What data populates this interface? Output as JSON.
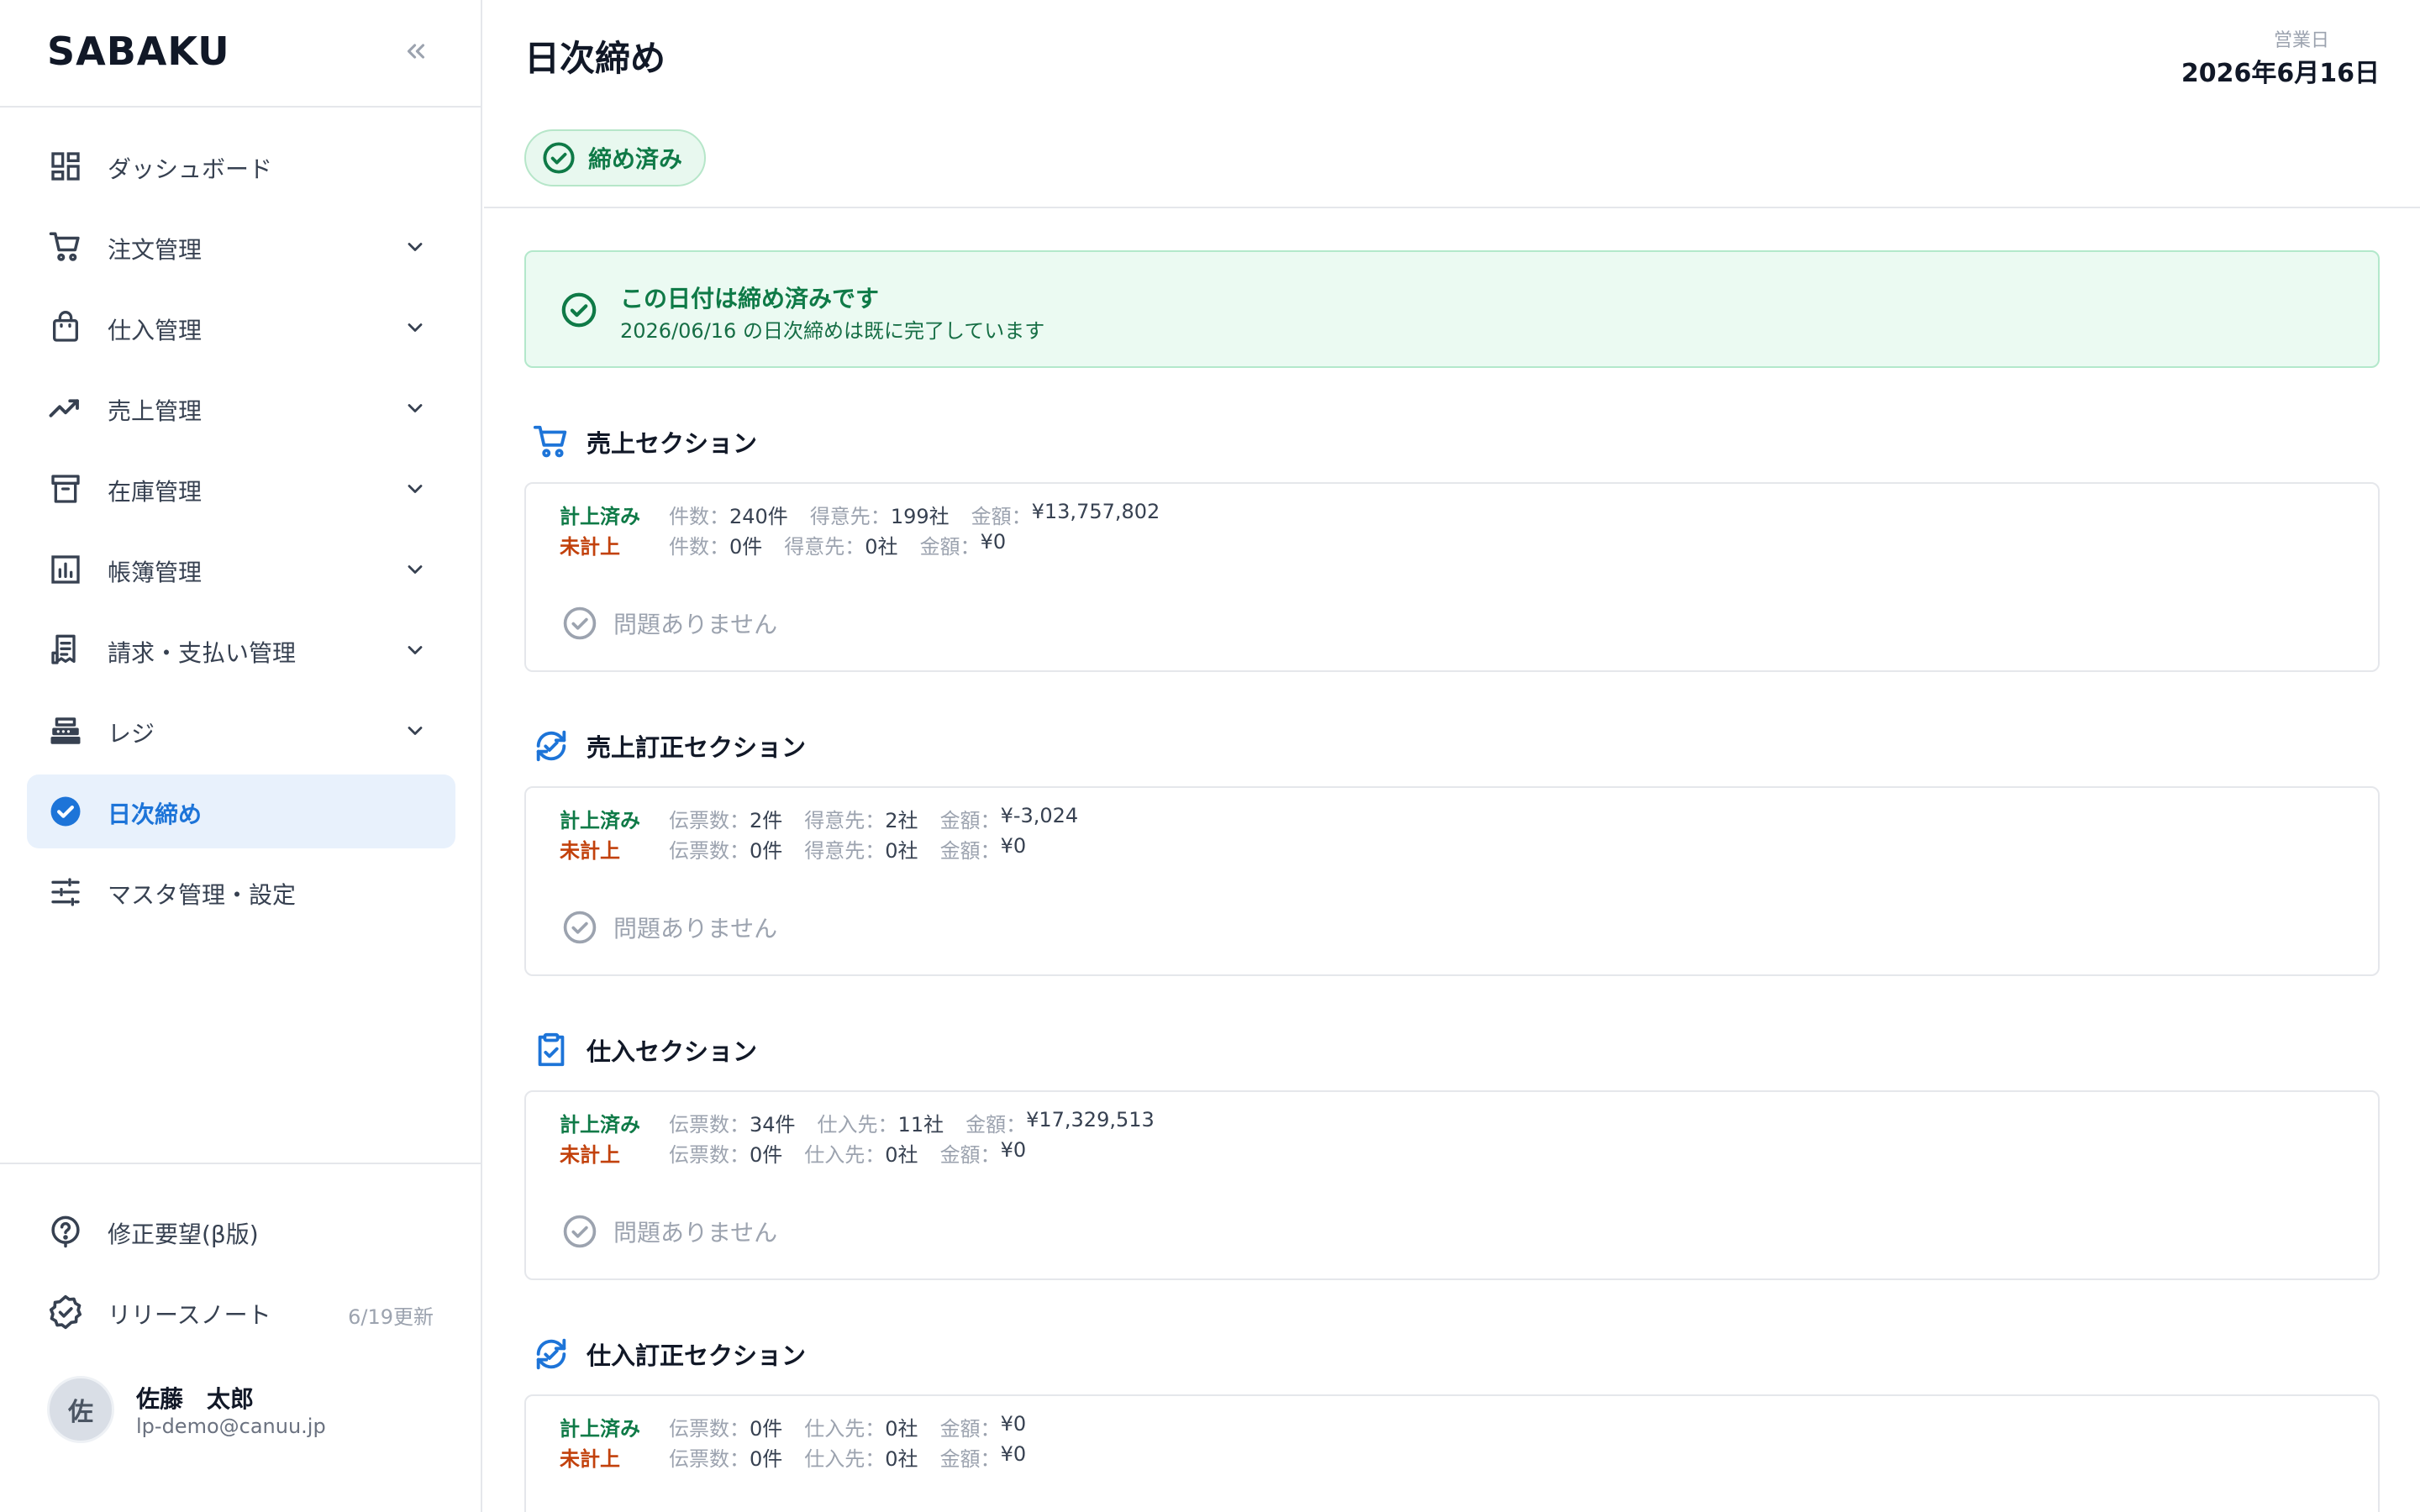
{
  "app": {
    "brand": "SABAKU"
  },
  "sidebar": {
    "items": [
      {
        "label": "ダッシュボード",
        "icon": "dashboard-icon",
        "has_children": false
      },
      {
        "label": "注文管理",
        "icon": "cart-icon",
        "has_children": true
      },
      {
        "label": "仕入管理",
        "icon": "shopping-bag-icon",
        "has_children": true
      },
      {
        "label": "売上管理",
        "icon": "trending-up-icon",
        "has_children": true
      },
      {
        "label": "在庫管理",
        "icon": "archive-box-icon",
        "has_children": true
      },
      {
        "label": "帳簿管理",
        "icon": "bar-chart-icon",
        "has_children": true
      },
      {
        "label": "請求・支払い管理",
        "icon": "receipt-icon",
        "has_children": true
      },
      {
        "label": "レジ",
        "icon": "cash-register-icon",
        "has_children": true
      },
      {
        "label": "日次締め",
        "icon": "check-circle-icon",
        "has_children": false,
        "active": true
      },
      {
        "label": "マスタ管理・設定",
        "icon": "sliders-icon",
        "has_children": false
      }
    ],
    "bottom": {
      "feedback_label": "修正要望(β版)",
      "release_label": "リリースノート",
      "release_meta": "6/19更新"
    },
    "user": {
      "avatar_initial": "佐",
      "name": "佐藤　太郎",
      "email": "lp-demo@canuu.jp"
    }
  },
  "header": {
    "title": "日次締め",
    "business_day_label": "営業日",
    "business_day_value": "2026年6月16日",
    "status_label": "締め済み"
  },
  "alert": {
    "title": "この日付は締め済みです",
    "description": "2026/06/16 の日次締めは既に完了しています"
  },
  "sections": [
    {
      "title": "売上セクション",
      "icon": "cart-icon",
      "recorded": {
        "status": "計上済み",
        "fields": [
          {
            "k": "件数：",
            "v": "240件"
          },
          {
            "k": "得意先：",
            "v": "199社"
          },
          {
            "k": "金額：",
            "v": "¥13,757,802"
          }
        ]
      },
      "unrecorded": {
        "status": "未計上",
        "fields": [
          {
            "k": "件数：",
            "v": "0件"
          },
          {
            "k": "得意先：",
            "v": "0社"
          },
          {
            "k": "金額：",
            "v": "¥0"
          }
        ]
      },
      "issue_text": "問題ありません"
    },
    {
      "title": "売上訂正セクション",
      "icon": "refresh-check-icon",
      "recorded": {
        "status": "計上済み",
        "fields": [
          {
            "k": "伝票数：",
            "v": "2件"
          },
          {
            "k": "得意先：",
            "v": "2社"
          },
          {
            "k": "金額：",
            "v": "¥-3,024"
          }
        ]
      },
      "unrecorded": {
        "status": "未計上",
        "fields": [
          {
            "k": "伝票数：",
            "v": "0件"
          },
          {
            "k": "得意先：",
            "v": "0社"
          },
          {
            "k": "金額：",
            "v": "¥0"
          }
        ]
      },
      "issue_text": "問題ありません"
    },
    {
      "title": "仕入セクション",
      "icon": "clipboard-check-icon",
      "recorded": {
        "status": "計上済み",
        "fields": [
          {
            "k": "伝票数：",
            "v": "34件"
          },
          {
            "k": "仕入先：",
            "v": "11社"
          },
          {
            "k": "金額：",
            "v": "¥17,329,513"
          }
        ]
      },
      "unrecorded": {
        "status": "未計上",
        "fields": [
          {
            "k": "伝票数：",
            "v": "0件"
          },
          {
            "k": "仕入先：",
            "v": "0社"
          },
          {
            "k": "金額：",
            "v": "¥0"
          }
        ]
      },
      "issue_text": "問題ありません"
    },
    {
      "title": "仕入訂正セクション",
      "icon": "refresh-check-icon",
      "recorded": {
        "status": "計上済み",
        "fields": [
          {
            "k": "伝票数：",
            "v": "0件"
          },
          {
            "k": "仕入先：",
            "v": "0社"
          },
          {
            "k": "金額：",
            "v": "¥0"
          }
        ]
      },
      "unrecorded": {
        "status": "未計上",
        "fields": [
          {
            "k": "伝票数：",
            "v": "0件"
          },
          {
            "k": "仕入先：",
            "v": "0社"
          },
          {
            "k": "金額：",
            "v": "¥0"
          }
        ]
      },
      "issue_text": ""
    }
  ],
  "colors": {
    "accent": "#1d74d8",
    "success": "#0f7a47",
    "warning": "#c2410c",
    "border": "#e5e7eb"
  }
}
